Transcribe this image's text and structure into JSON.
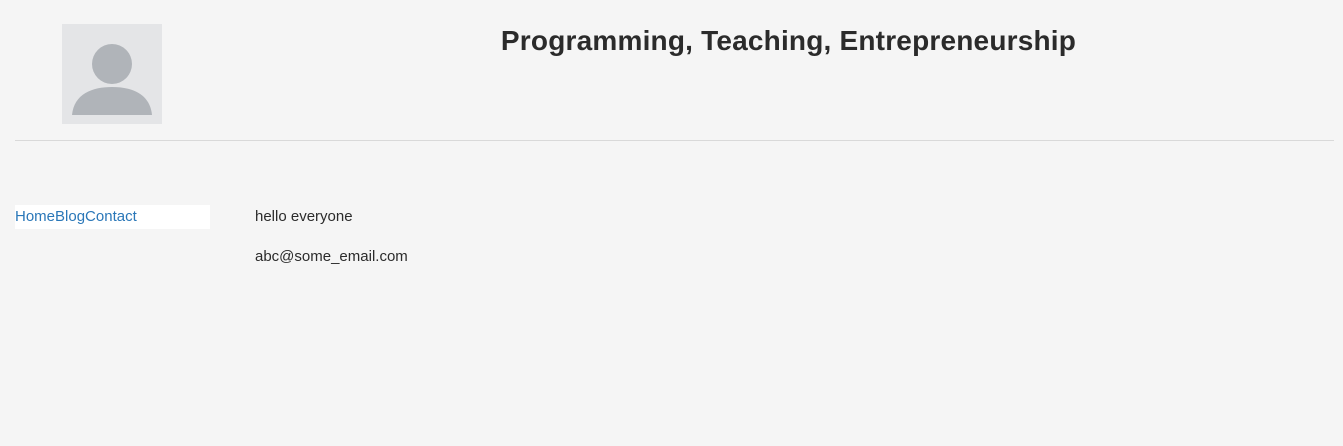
{
  "header": {
    "title": "Programming, Teaching, Entrepreneurship",
    "avatar_icon": "user-placeholder-icon"
  },
  "nav": {
    "items": [
      {
        "label": "Home"
      },
      {
        "label": "Blog"
      },
      {
        "label": "Contact"
      }
    ]
  },
  "main": {
    "greeting": "hello everyone",
    "email": "abc@some_email.com"
  },
  "colors": {
    "background": "#f5f5f5",
    "link": "#2a77b8",
    "text": "#2b2b2b",
    "avatar_bg": "#e4e5e7",
    "avatar_fg": "#b0b4b9"
  }
}
